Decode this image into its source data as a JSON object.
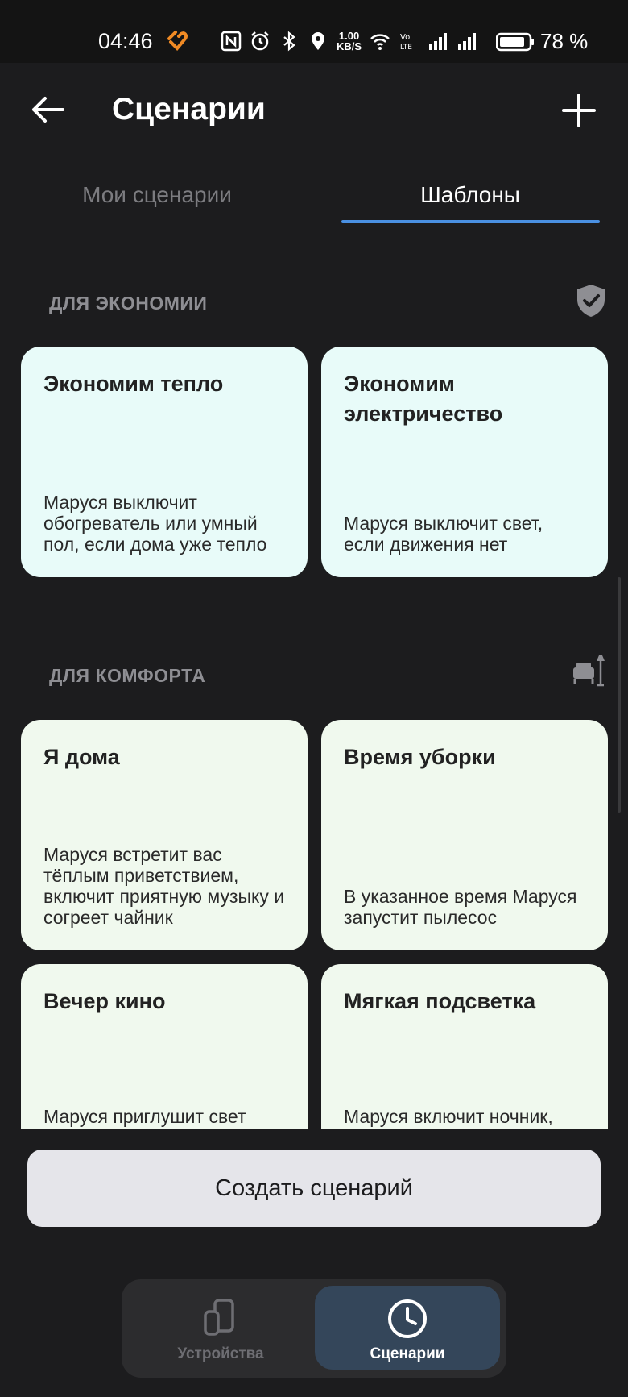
{
  "status_bar": {
    "time": "04:46",
    "speed_top": "1.00",
    "speed_bottom": "KB/S",
    "battery_pct": "78 %",
    "icons": [
      "heart-app-icon",
      "nfc-icon",
      "alarm-icon",
      "bluetooth-icon",
      "location-icon",
      "wifi-icon",
      "volte-icon",
      "signal-icon",
      "signal-icon",
      "battery-icon"
    ]
  },
  "header": {
    "title": "Сценарии",
    "back_icon": "arrow-left-icon",
    "add_icon": "plus-icon"
  },
  "tabs": [
    {
      "label": "Мои сценарии",
      "active": false
    },
    {
      "label": "Шаблоны",
      "active": true
    }
  ],
  "colors": {
    "accent": "#4a90e2",
    "eco_card": "#e8fbf9",
    "comfort_card": "#f0f9ee",
    "background": "#1c1c1e",
    "active_nav": "#34465a"
  },
  "sections": [
    {
      "title": "ДЛЯ ЭКОНОМИИ",
      "icon": "shield-check-icon",
      "cards": [
        {
          "title": "Экономим тепло",
          "desc": "Маруся выключит обогреватель или умный пол, если дома уже тепло"
        },
        {
          "title": "Экономим электричество",
          "desc": "Маруся выключит свет, если движения нет"
        }
      ]
    },
    {
      "title": "ДЛЯ КОМФОРТА",
      "icon": "armchair-lamp-icon",
      "cards": [
        {
          "title": "Я дома",
          "desc": "Маруся встретит вас тёплым приветствием, включит приятную музыку и согреет чайник"
        },
        {
          "title": "Время уборки",
          "desc": "В указанное время Маруся запустит пылесос"
        },
        {
          "title": "Вечер кино",
          "desc": "Маруся приглушит свет"
        },
        {
          "title": "Мягкая подсветка",
          "desc": "Маруся включит ночник,"
        }
      ]
    }
  ],
  "create_button": {
    "label": "Создать сценарий"
  },
  "bottom_nav": [
    {
      "label": "Устройства",
      "icon": "devices-icon",
      "active": false
    },
    {
      "label": "Сценарии",
      "icon": "clock-icon",
      "active": true
    }
  ]
}
